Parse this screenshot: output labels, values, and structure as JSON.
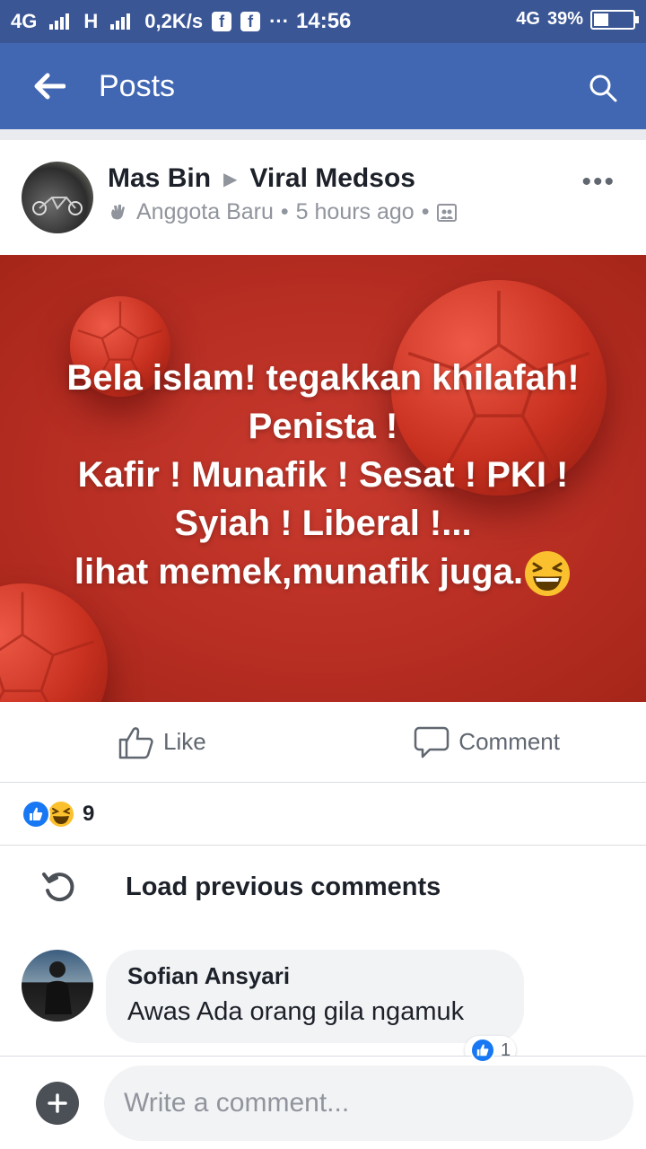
{
  "status_bar": {
    "network1": "4G",
    "network2": "H",
    "speed": "0,2K/s",
    "more": "···",
    "time": "14:56",
    "network3": "4G",
    "battery": "39%",
    "battery_level": 0.39
  },
  "app_bar": {
    "title": "Posts",
    "back_icon": "arrow-left-icon",
    "search_icon": "search-icon"
  },
  "post": {
    "author": "Mas Bin",
    "group": "Viral Medsos",
    "badge": "Anggota Baru",
    "time": "5 hours ago",
    "more": "•••",
    "text_lines": [
      "Bela islam! tegakkan khilafah!",
      "Penista !",
      "Kafir ! Munafik ! Sesat ! PKI !",
      "Syiah ! Liberal !...",
      "lihat memek,munafik juga."
    ],
    "actions": {
      "like": "Like",
      "comment": "Comment"
    },
    "reaction_count": "9"
  },
  "comments": {
    "load_previous": "Load previous comments",
    "items": [
      {
        "author": "Sofian Ansyari",
        "text": "Awas Ada orang gila ngamuk",
        "reaction_count": "1"
      }
    ]
  },
  "composer": {
    "placeholder": "Write a comment..."
  },
  "colors": {
    "status_bar": "#3a5695",
    "app_bar": "#4267b2",
    "post_bg": "#b62d22"
  }
}
